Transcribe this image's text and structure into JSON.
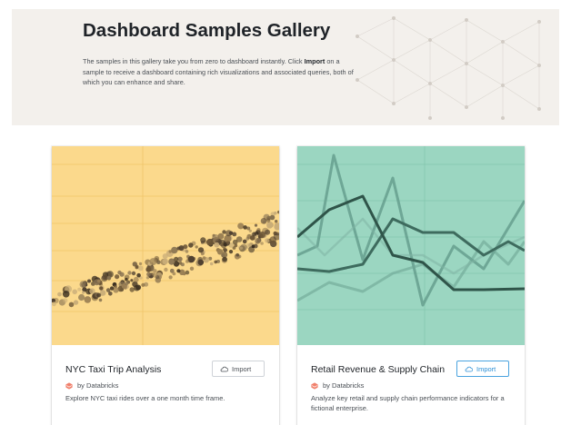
{
  "hero": {
    "title": "Dashboard Samples Gallery",
    "description_pre": "The samples in this gallery take you from zero to dashboard instantly. Click ",
    "description_bold": "Import",
    "description_post": " on a sample to receive a dashboard containing rich visualizations and associated queries, both of which you can enhance and share."
  },
  "cards": [
    {
      "title": "NYC Taxi Trip Analysis",
      "author": "by Databricks",
      "description": "Explore NYC taxi rides over a one month time frame.",
      "import_label": "Import",
      "preview_color": "#fbd98c"
    },
    {
      "title": "Retail Revenue & Supply Chain",
      "author": "by Databricks",
      "description": "Analyze key retail and supply chain performance indicators for a fictional enterprise.",
      "import_label": "Import",
      "preview_color": "#9bd6c1"
    }
  ],
  "icons": {
    "brand": "databricks-icon",
    "import": "cloud-icon"
  },
  "colors": {
    "hero_bg": "#f3f0ec",
    "import_highlight": "#2b8fd6"
  }
}
